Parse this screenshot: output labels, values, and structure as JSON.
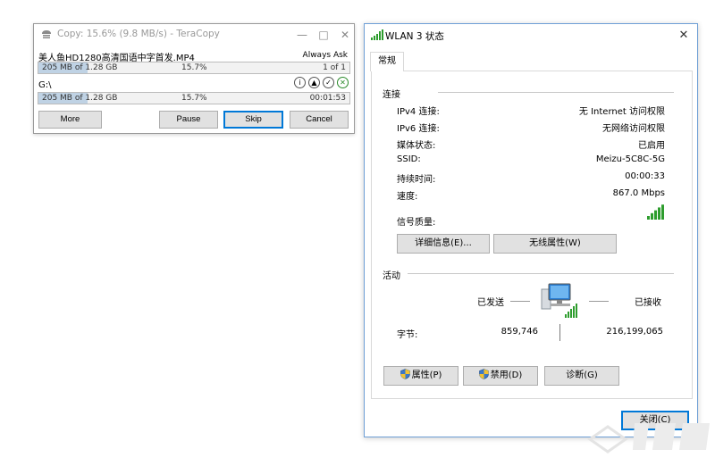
{
  "teracopy": {
    "title": "Copy: 15.6%  (9.8 MB/s) - TeraCopy",
    "filename": "美人鱼HD1280高清国语中字首发.MP4",
    "on_exist": "Always Ask",
    "file_progress": {
      "size_text": "205 MB of 1.28 GB",
      "percent_text": "15.7%",
      "count_text": "1 of 1",
      "fraction": 0.157
    },
    "destination": "G:\\",
    "total_progress": {
      "size_text": "205 MB of 1.28 GB",
      "percent_text": "15.7%",
      "time_text": "00:01:53",
      "fraction": 0.157
    },
    "buttons": {
      "more": "More",
      "pause": "Pause",
      "skip": "Skip",
      "cancel": "Cancel"
    }
  },
  "wlan": {
    "title": "WLAN 3 状态",
    "tab_general": "常规",
    "connection": {
      "heading": "连接",
      "ipv4_label": "IPv4 连接:",
      "ipv4_value": "无 Internet 访问权限",
      "ipv6_label": "IPv6 连接:",
      "ipv6_value": "无网络访问权限",
      "media_label": "媒体状态:",
      "media_value": "已启用",
      "ssid_label": "SSID:",
      "ssid_value": "Meizu-5C8C-5G",
      "duration_label": "持续时间:",
      "duration_value": "00:00:33",
      "speed_label": "速度:",
      "speed_value": "867.0 Mbps",
      "signal_label": "信号质量:",
      "signal_bars": 5,
      "details_button": "详细信息(E)...",
      "wireless_props_button": "无线属性(W)"
    },
    "activity": {
      "heading": "活动",
      "sent_label": "已发送",
      "received_label": "已接收",
      "bytes_label": "字节:",
      "bytes_sent": "859,746",
      "bytes_received": "216,199,065"
    },
    "buttons": {
      "properties": "属性(P)",
      "disable": "禁用(D)",
      "diagnose": "诊断(G)",
      "close": "关闭(C)"
    }
  },
  "colors": {
    "accent": "#0078d7",
    "progress_fill": "#bfd2e4",
    "signal": "#2e9d2e"
  },
  "icons": [
    "teracopy-app-icon",
    "wifi-signal-icon",
    "network-computer-icon",
    "shield-icon",
    "close-icon",
    "minimize-icon",
    "maximize-icon"
  ]
}
